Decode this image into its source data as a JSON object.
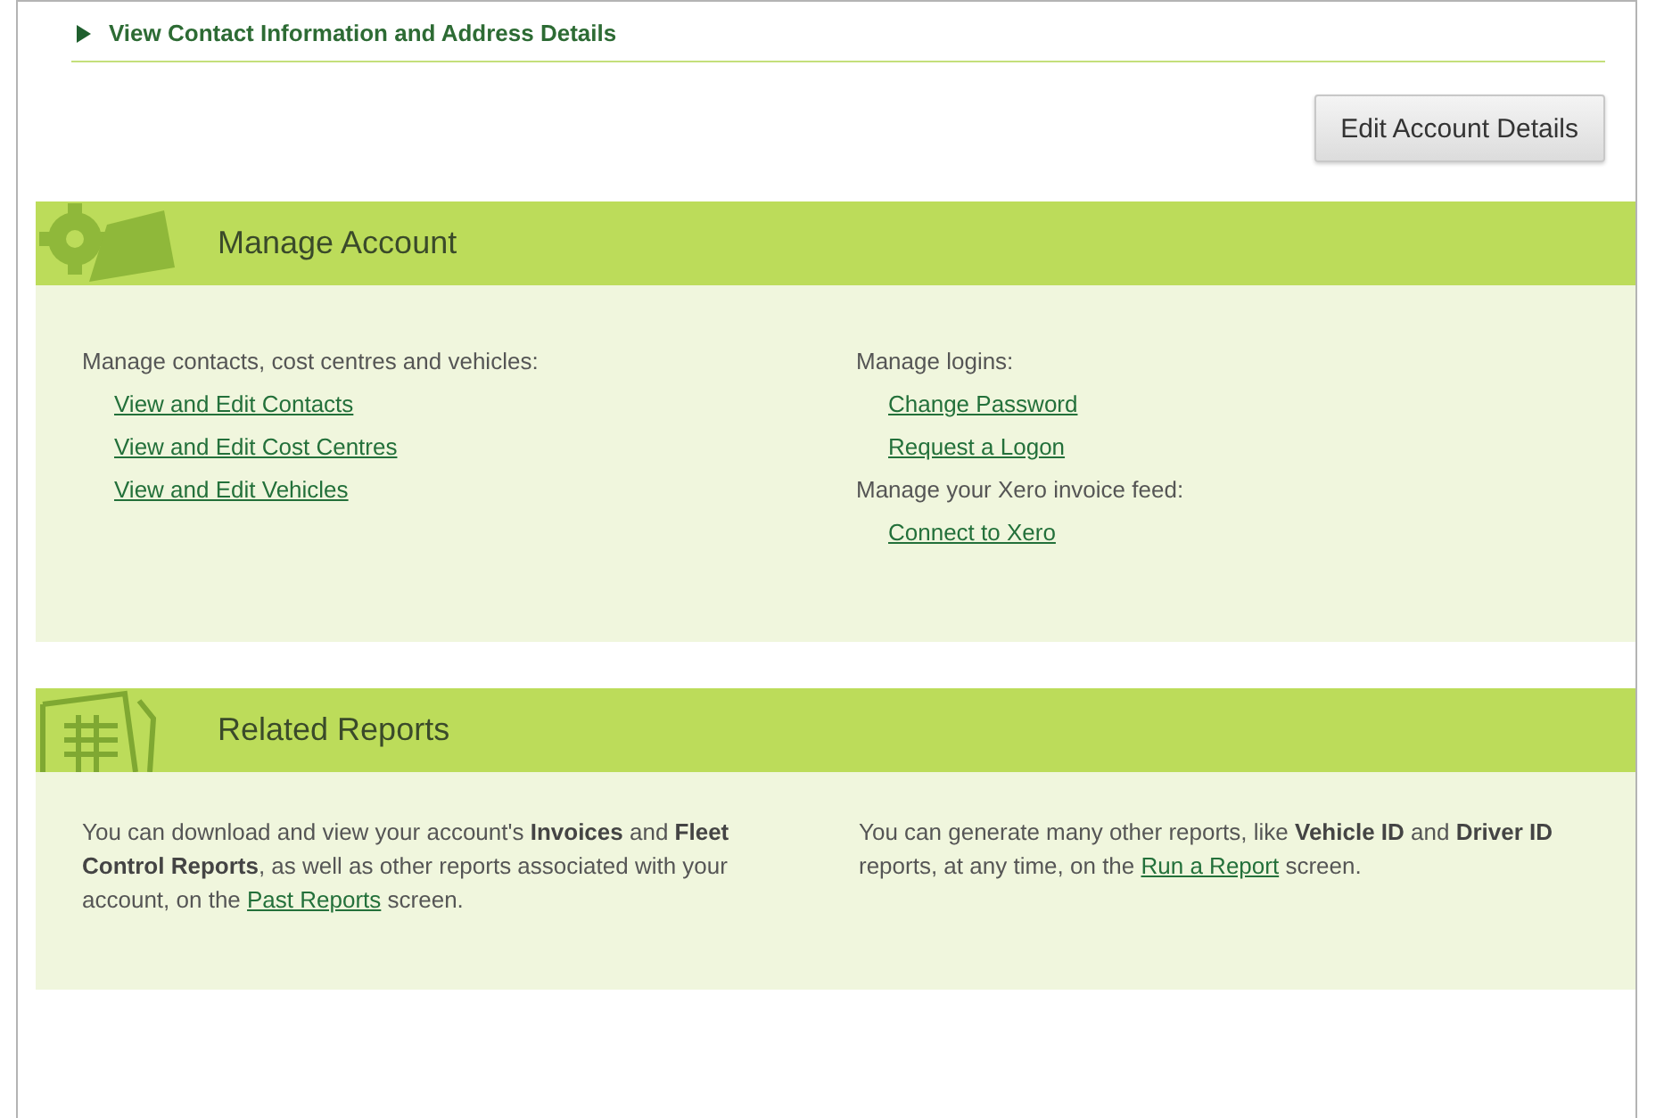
{
  "contact_toggle": {
    "label": "View Contact Information and Address Details",
    "expanded": false
  },
  "edit_button": "Edit Account Details",
  "manage_account": {
    "title": "Manage Account",
    "columns": [
      {
        "groups": [
          {
            "heading": "Manage contacts, cost centres and vehicles:",
            "links": [
              "View and Edit Contacts",
              "View and Edit Cost Centres",
              "View and Edit Vehicles"
            ]
          }
        ]
      },
      {
        "groups": [
          {
            "heading": "Manage logins:",
            "links": [
              "Change Password",
              "Request a Logon"
            ]
          },
          {
            "heading": "Manage your Xero invoice feed:",
            "links": [
              "Connect to Xero"
            ]
          }
        ]
      }
    ]
  },
  "related_reports": {
    "title": "Related Reports",
    "paragraphs": [
      {
        "text_before": "You can download and view your account's **Invoices** and **Fleet Control Reports**, as well as other reports associated with your account, on the ",
        "link": "Past Reports",
        "text_after": " screen."
      },
      {
        "text_before": "You can generate many other reports, like **Vehicle ID** and **Driver ID** reports, at any time, on the ",
        "link": "Run a Report",
        "text_after": " screen."
      }
    ]
  }
}
